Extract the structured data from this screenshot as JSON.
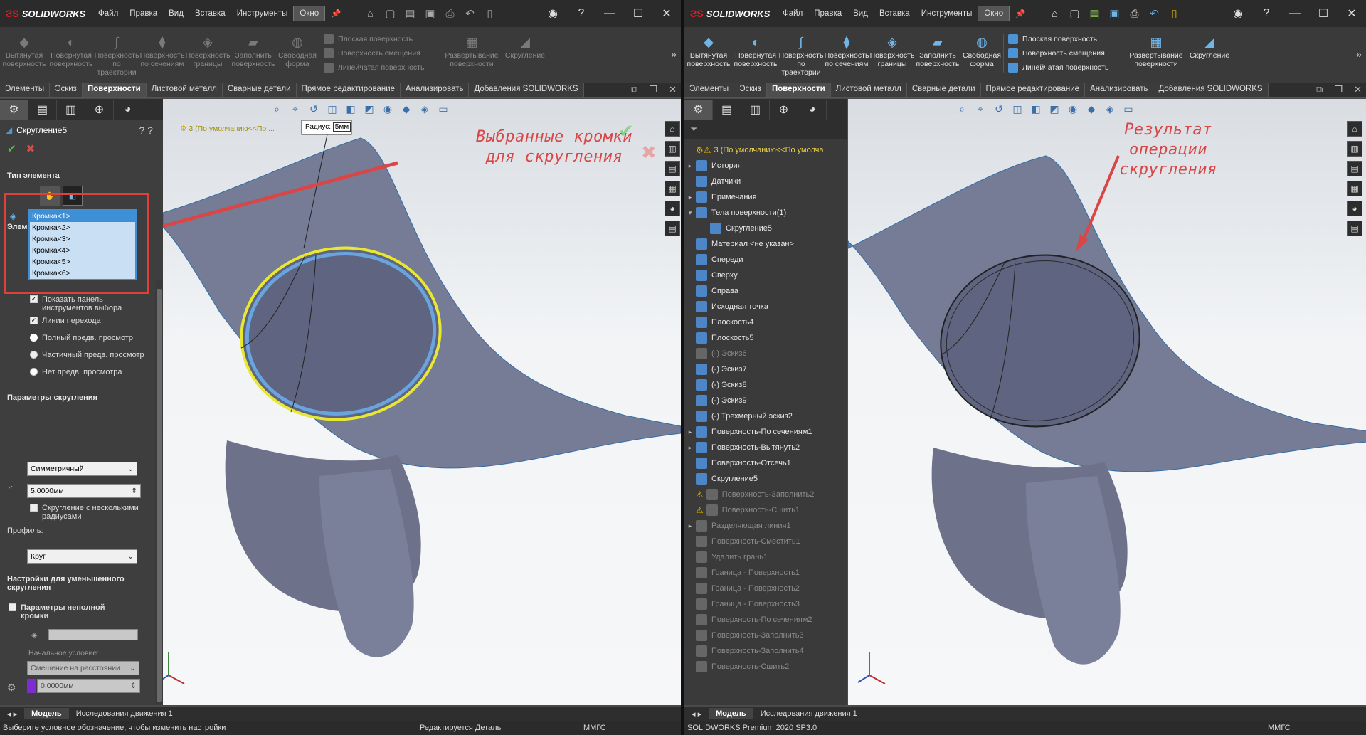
{
  "app": {
    "brand": "SOLIDWORKS",
    "menu": [
      "Файл",
      "Правка",
      "Вид",
      "Вставка",
      "Инструменты",
      "Окно"
    ]
  },
  "ribbon": {
    "buttons": [
      {
        "label": "Вытянутая поверхность",
        "icon": "extruded-surface-icon"
      },
      {
        "label": "Повернутая поверхность",
        "icon": "revolved-surface-icon"
      },
      {
        "label": "Поверхность по траектории",
        "icon": "swept-surface-icon"
      },
      {
        "label": "Поверхность по сечениям",
        "icon": "lofted-surface-icon"
      },
      {
        "label": "Поверхность границы",
        "icon": "boundary-surface-icon"
      },
      {
        "label": "Заполнить поверхность",
        "icon": "filled-surface-icon"
      },
      {
        "label": "Свободная форма",
        "icon": "freeform-icon"
      }
    ],
    "col": [
      "Плоская поверхность",
      "Поверхность смещения",
      "Линейчатая поверхность"
    ],
    "extra1": "Развертывание поверхности",
    "extra2": "Скругление"
  },
  "tabs": [
    "Элементы",
    "Эскиз",
    "Поверхности",
    "Листовой металл",
    "Сварные детали",
    "Прямое редактирование",
    "Анализировать",
    "Добавления SOLIDWORKS"
  ],
  "active_tab": "Поверхности",
  "left": {
    "pm_title": "Скругление5",
    "crumb": "3  (По умолчанию<<По ...",
    "section_type": "Тип элемента",
    "section_items": "Элементы для скругления",
    "edges": [
      "Кромка<1>",
      "Кромка<2>",
      "Кромка<3>",
      "Кромка<4>",
      "Кромка<5>",
      "Кромка<6>"
    ],
    "chk_show_panel": "Показать панель инструментов выбора",
    "chk_tangent": "Линии перехода",
    "rad_full": "Полный предв. просмотр",
    "rad_partial": "Частичный предв. просмотр",
    "rad_none": "Нет предв. просмотра",
    "section_params": "Параметры скругления",
    "symmetric": "Симметричный",
    "radius_value": "5.0000мм",
    "multi_radius": "Скругление с несколькими радиусами",
    "profile_label": "Профиль:",
    "profile_value": "Круг",
    "section_setback": "Настройки для уменьшенного скругления",
    "section_partial": "Параметры неполной кромки",
    "start_cond": "Начальное условие:",
    "offset_dist": "Смещение на расстоянии",
    "offset_value": "0.0000мм",
    "radius_label": "Радиус:",
    "radius_tag": "5мм",
    "annotation": "Выбранные кромки\nдля скругления",
    "status": "Выберите условное обозначение, чтобы изменить настройки",
    "status_edit": "Редактируется Деталь",
    "units": "ММГС"
  },
  "right": {
    "root": "3  (По умолчанию<<По умолча",
    "tree": [
      {
        "label": "История",
        "exp": "▸",
        "dim": false
      },
      {
        "label": "Датчики",
        "exp": "",
        "dim": false
      },
      {
        "label": "Примечания",
        "exp": "▸",
        "dim": false
      },
      {
        "label": "Тела поверхности(1)",
        "exp": "▾",
        "dim": false
      },
      {
        "label": "Скругление5",
        "exp": "",
        "dim": false,
        "indent": true
      },
      {
        "label": "Материал <не указан>",
        "exp": "",
        "dim": false
      },
      {
        "label": "Спереди",
        "exp": "",
        "dim": false
      },
      {
        "label": "Сверху",
        "exp": "",
        "dim": false
      },
      {
        "label": "Справа",
        "exp": "",
        "dim": false
      },
      {
        "label": "Исходная точка",
        "exp": "",
        "dim": false
      },
      {
        "label": "Плоскость4",
        "exp": "",
        "dim": false
      },
      {
        "label": "Плоскость5",
        "exp": "",
        "dim": false
      },
      {
        "label": "(-) Эскиз6",
        "exp": "",
        "dim": true
      },
      {
        "label": "(-) Эскиз7",
        "exp": "",
        "dim": false
      },
      {
        "label": "(-) Эскиз8",
        "exp": "",
        "dim": false
      },
      {
        "label": "(-) Эскиз9",
        "exp": "",
        "dim": false
      },
      {
        "label": "(-) Трехмерный эскиз2",
        "exp": "",
        "dim": false
      },
      {
        "label": "Поверхность-По сечениям1",
        "exp": "▸",
        "dim": false
      },
      {
        "label": "Поверхность-Вытянуть2",
        "exp": "▸",
        "dim": false
      },
      {
        "label": "Поверхность-Отсечь1",
        "exp": "",
        "dim": false
      },
      {
        "label": "Скругление5",
        "exp": "",
        "dim": false
      },
      {
        "label": "Поверхность-Заполнить2",
        "exp": "",
        "dim": true,
        "warn": true
      },
      {
        "label": "Поверхность-Сшить1",
        "exp": "",
        "dim": true,
        "warn": true
      },
      {
        "label": "Разделяющая линия1",
        "exp": "▸",
        "dim": true
      },
      {
        "label": "Поверхность-Сместить1",
        "exp": "",
        "dim": true
      },
      {
        "label": "Удалить грань1",
        "exp": "",
        "dim": true
      },
      {
        "label": "Граница - Поверхность1",
        "exp": "",
        "dim": true
      },
      {
        "label": "Граница - Поверхность2",
        "exp": "",
        "dim": true
      },
      {
        "label": "Граница - Поверхность3",
        "exp": "",
        "dim": true
      },
      {
        "label": "Поверхность-По сечениям2",
        "exp": "",
        "dim": true
      },
      {
        "label": "Поверхность-Заполнить3",
        "exp": "",
        "dim": true
      },
      {
        "label": "Поверхность-Заполнить4",
        "exp": "",
        "dim": true
      },
      {
        "label": "Поверхность-Сшить2",
        "exp": "",
        "dim": true
      }
    ],
    "annotation": "Результат операции\nскругления",
    "status": "SOLIDWORKS Premium 2020 SP3.0",
    "units": "ММГС"
  },
  "model_tabs": [
    "Модель",
    "Исследования движения 1"
  ]
}
